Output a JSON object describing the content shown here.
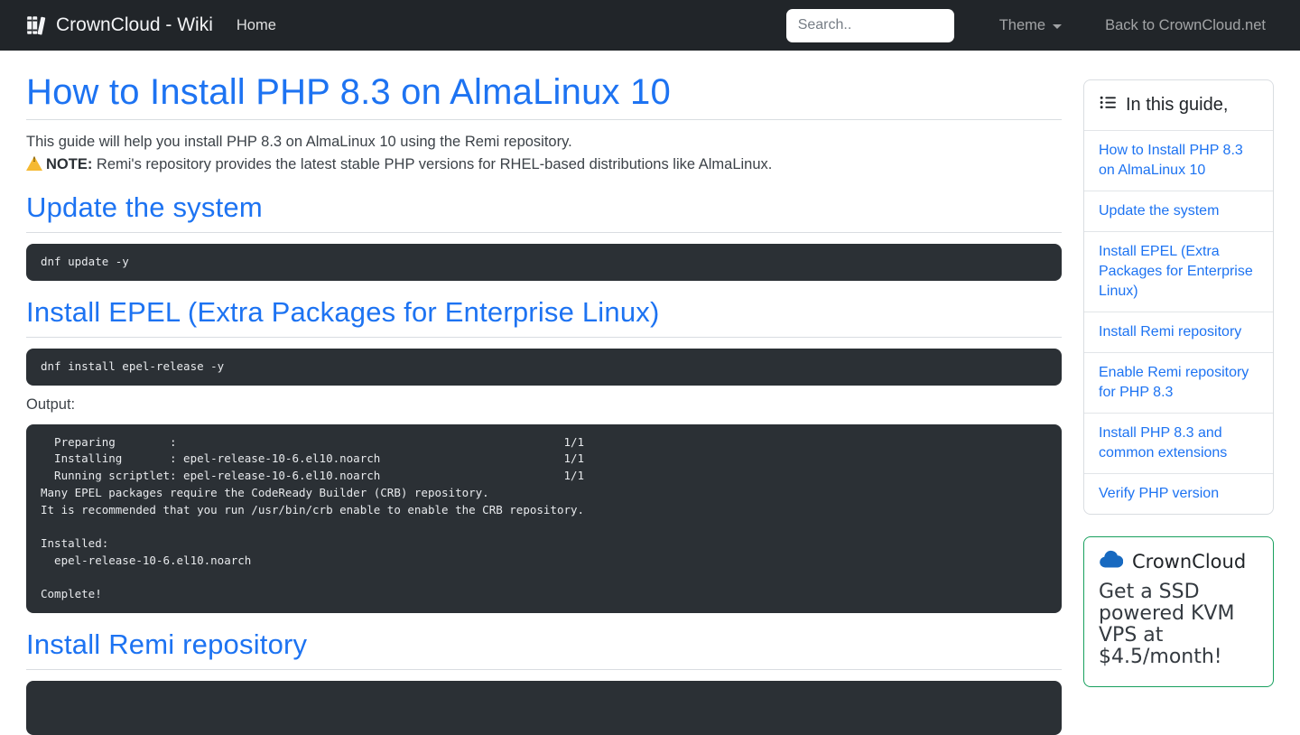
{
  "colors": {
    "accent_blue": "#1d73f2",
    "navbar_bg": "#212529",
    "code_bg": "#2b3035",
    "promo_border_green": "#18a05e",
    "cloud_blue": "#1769c0",
    "warning_yellow": "#f5b932"
  },
  "navbar": {
    "brand": "CrownCloud - Wiki",
    "home": "Home",
    "search_placeholder": "Search..",
    "theme": "Theme",
    "back": "Back to CrownCloud.net"
  },
  "article": {
    "title": "How to Install PHP 8.3 on AlmaLinux 10",
    "intro": "This guide will help you install PHP 8.3 on AlmaLinux 10 using the Remi repository.",
    "note_label": "NOTE:",
    "note_text": " Remi's repository provides the latest stable PHP versions for RHEL-based distributions like AlmaLinux.",
    "sections": [
      {
        "heading": "Update the system",
        "code": "dnf update -y"
      },
      {
        "heading": "Install EPEL (Extra Packages for Enterprise Linux)",
        "code": "dnf install epel-release -y",
        "output_label": "Output:",
        "output": "  Preparing        :                                                         1/1 \n  Installing       : epel-release-10-6.el10.noarch                           1/1 \n  Running scriptlet: epel-release-10-6.el10.noarch                           1/1 \nMany EPEL packages require the CodeReady Builder (CRB) repository.\nIt is recommended that you run /usr/bin/crb enable to enable the CRB repository.\n\nInstalled:\n  epel-release-10-6.el10.noarch\n\nComplete!"
      },
      {
        "heading": "Install Remi repository",
        "code": ""
      }
    ]
  },
  "sidebar": {
    "toc": {
      "title": "In this guide,",
      "items": [
        "How to Install PHP 8.3 on AlmaLinux 10",
        "Update the system",
        "Install EPEL (Extra Packages for Enterprise Linux)",
        "Install Remi repository",
        "Enable Remi repository for PHP 8.3",
        "Install PHP 8.3 and common extensions",
        "Verify PHP version"
      ]
    },
    "promo": {
      "title": "CrownCloud",
      "text": "Get a SSD powered KVM VPS at $4.5/month!"
    }
  }
}
